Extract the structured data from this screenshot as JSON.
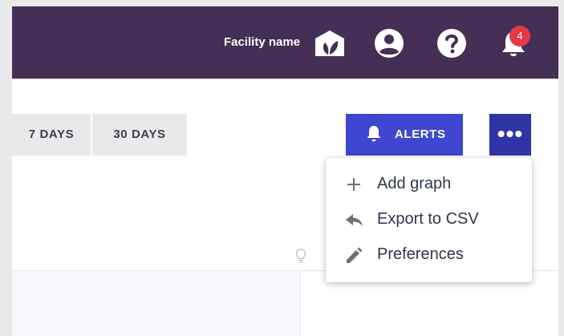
{
  "header": {
    "facility_name": "Facility name",
    "notification_count": "4",
    "icons": {
      "facility": "facility-leaf-icon",
      "account": "user-icon",
      "help": "help-icon",
      "notifications": "bell-icon"
    }
  },
  "toolbar": {
    "ranges": [
      {
        "label": "7 DAYS"
      },
      {
        "label": "30 DAYS"
      }
    ],
    "alerts_label": "ALERTS",
    "more_icon": "ellipsis-icon"
  },
  "menu": {
    "items": [
      {
        "label": "Add graph",
        "icon": "plus-icon"
      },
      {
        "label": "Export to CSV",
        "icon": "reply-arrow-icon"
      },
      {
        "label": "Preferences",
        "icon": "pencil-icon"
      }
    ]
  },
  "colors": {
    "header_bg": "#452f55",
    "primary": "#3f47d1",
    "primary_dark": "#2f35a4",
    "badge": "#e53946",
    "range_bg": "#e8e9eb"
  }
}
